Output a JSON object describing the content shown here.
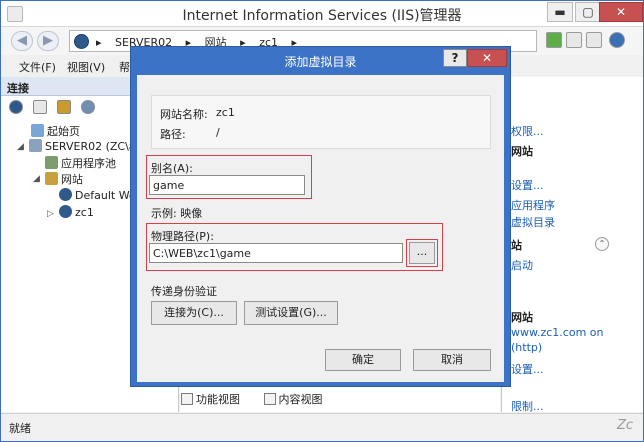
{
  "window": {
    "title": "Internet Information Services (IIS)管理器",
    "min": "▬",
    "max": "▢",
    "close": "✕"
  },
  "address": {
    "crumbs": [
      "SERVER02",
      "网站",
      "zc1"
    ],
    "sep": "▸"
  },
  "menu": [
    "文件(F)",
    "视图(V)",
    "帮助"
  ],
  "left_pane": {
    "heading": "连接",
    "tree": [
      {
        "label": "起始页"
      },
      {
        "label": "SERVER02 (ZC\\adi"
      },
      {
        "label": "应用程序池"
      },
      {
        "label": "网站"
      },
      {
        "label": "Default Web"
      },
      {
        "label": "zc1"
      }
    ]
  },
  "view_tabs": {
    "features": "功能视图",
    "content": "内容视图"
  },
  "actions": {
    "items": [
      "权限...",
      "网站",
      "设置...",
      "应用程序",
      "虚拟目录",
      "站",
      "启动",
      "网站",
      "www.zc1.com on",
      "(http)",
      "设置...",
      "限制..."
    ]
  },
  "status": {
    "text": "就绪",
    "watermark": "Zc"
  },
  "dialog": {
    "title": "添加虚拟目录",
    "help": "?",
    "close": "✕",
    "site_name_label": "网站名称:",
    "site_name_value": "zc1",
    "path_label": "路径:",
    "path_value": "/",
    "alias_label": "别名(A):",
    "alias_value": "game",
    "example": "示例: 映像",
    "physical_label": "物理路径(P):",
    "physical_value": "C:\\WEB\\zc1\\game",
    "browse": "...",
    "auth_label": "传递身份验证",
    "connect_as": "连接为(C)...",
    "test_settings": "测试设置(G)...",
    "ok": "确定",
    "cancel": "取消"
  }
}
